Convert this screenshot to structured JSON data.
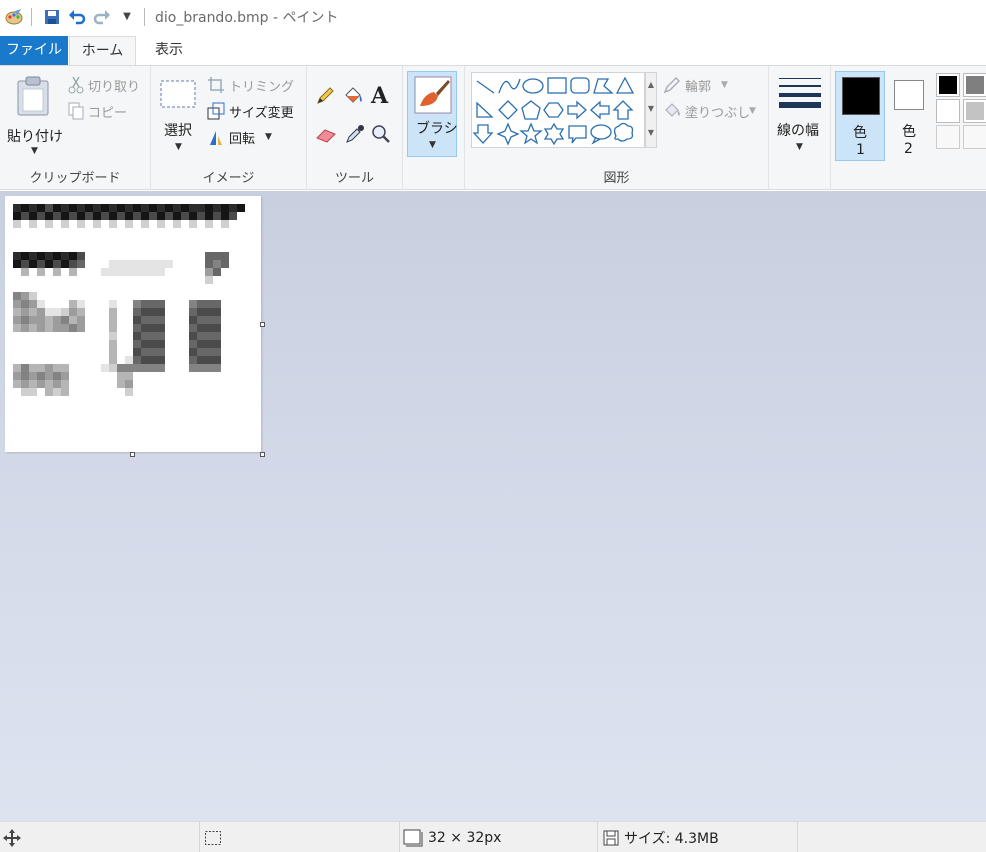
{
  "titlebar": {
    "app_icon": "paint-palette-icon",
    "title": "dio_brando.bmp - ペイント",
    "quick_access": [
      "save-icon",
      "undo-icon",
      "redo-icon",
      "customize-dropdown-icon"
    ]
  },
  "tabs": [
    {
      "label": "ファイル",
      "active": false
    },
    {
      "label": "ホーム",
      "active": true
    },
    {
      "label": "表示",
      "active": false
    }
  ],
  "ribbon": {
    "clipboard": {
      "label": "クリップボード",
      "paste": "貼り付け",
      "cut": "切り取り",
      "copy": "コピー"
    },
    "image": {
      "label": "イメージ",
      "select": "選択",
      "crop": "トリミング",
      "resize": "サイズ変更",
      "rotate": "回転"
    },
    "tools": {
      "label": "ツール",
      "items": [
        "pencil-icon",
        "fill-bucket-icon",
        "text-icon",
        "eraser-icon",
        "color-picker-icon",
        "magnifier-icon"
      ]
    },
    "brush": {
      "label": "ブラシ"
    },
    "shapes": {
      "label": "図形",
      "outline": "輪郭",
      "fill": "塗りつぶし"
    },
    "size": {
      "label": "線の幅"
    },
    "colors": {
      "color1_label_a": "色",
      "color1_label_b": "1",
      "color2_label_a": "色",
      "color2_label_b": "2",
      "color1": "#000000",
      "color2": "#ffffff",
      "palette": [
        "#000000",
        "#7f7f7f",
        "#ffffff",
        "#c3c3c3",
        "#ffffff",
        "#ffffff"
      ]
    }
  },
  "status": {
    "cursor_position": "",
    "selection_size": "",
    "canvas_size": "32 × 32px",
    "file_size": "サイズ: 4.3MB"
  },
  "colors": {
    "accent": "#1979ca",
    "selected_tool_bg": "#cce4f7"
  }
}
